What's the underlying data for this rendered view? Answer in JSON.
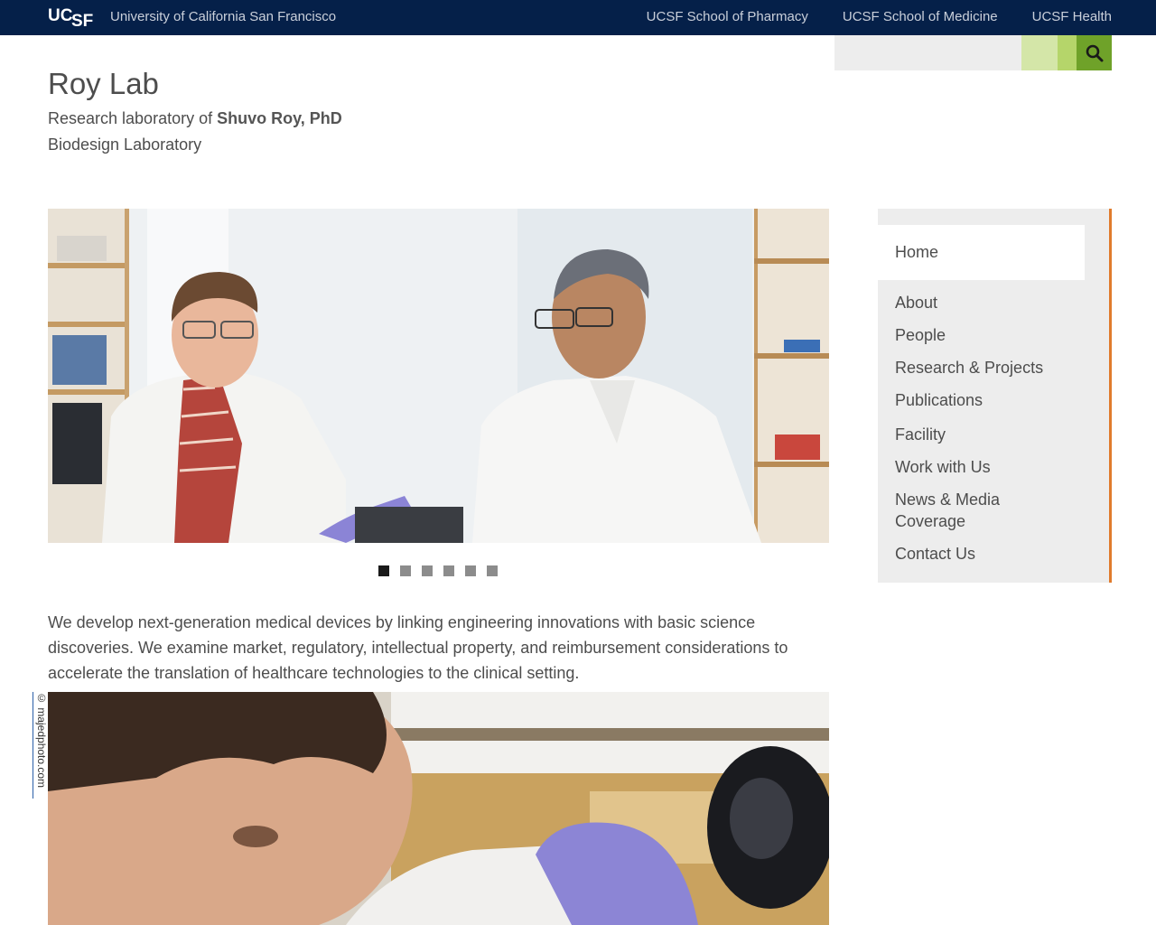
{
  "topbar": {
    "logo_text": "UCSF",
    "university": "University of California San Francisco",
    "links": [
      "UCSF School of Pharmacy",
      "UCSF School of Medicine",
      "UCSF Health"
    ]
  },
  "search": {
    "value": "",
    "icon": "search-icon"
  },
  "header": {
    "title": "Roy Lab",
    "subtitle_prefix": "Research laboratory of ",
    "subtitle_name": "Shuvo Roy, PhD",
    "subtitle2": "Biodesign Laboratory"
  },
  "slideshow": {
    "slide_count": 6,
    "active_index": 0
  },
  "intro": "We develop next-generation medical devices by linking engineering innovations with basic science discoveries. We examine market, regulatory, intellectual property, and reimbursement considerations to accelerate the translation of healthcare technologies to the clinical setting.",
  "photo_credit": "© majedphoto.com",
  "sidenav": {
    "items": [
      {
        "label": "Home"
      },
      {
        "label": "About"
      },
      {
        "label": "People"
      },
      {
        "label": "Research & Projects"
      },
      {
        "label": "Publications"
      },
      {
        "label": "Facility"
      },
      {
        "label": "Work with Us"
      },
      {
        "label": "News & Media Coverage"
      },
      {
        "label": "Contact Us"
      }
    ]
  },
  "colors": {
    "topbar": "#052049",
    "search_button": "#6fa229",
    "nav_accent": "#e07b2c"
  }
}
